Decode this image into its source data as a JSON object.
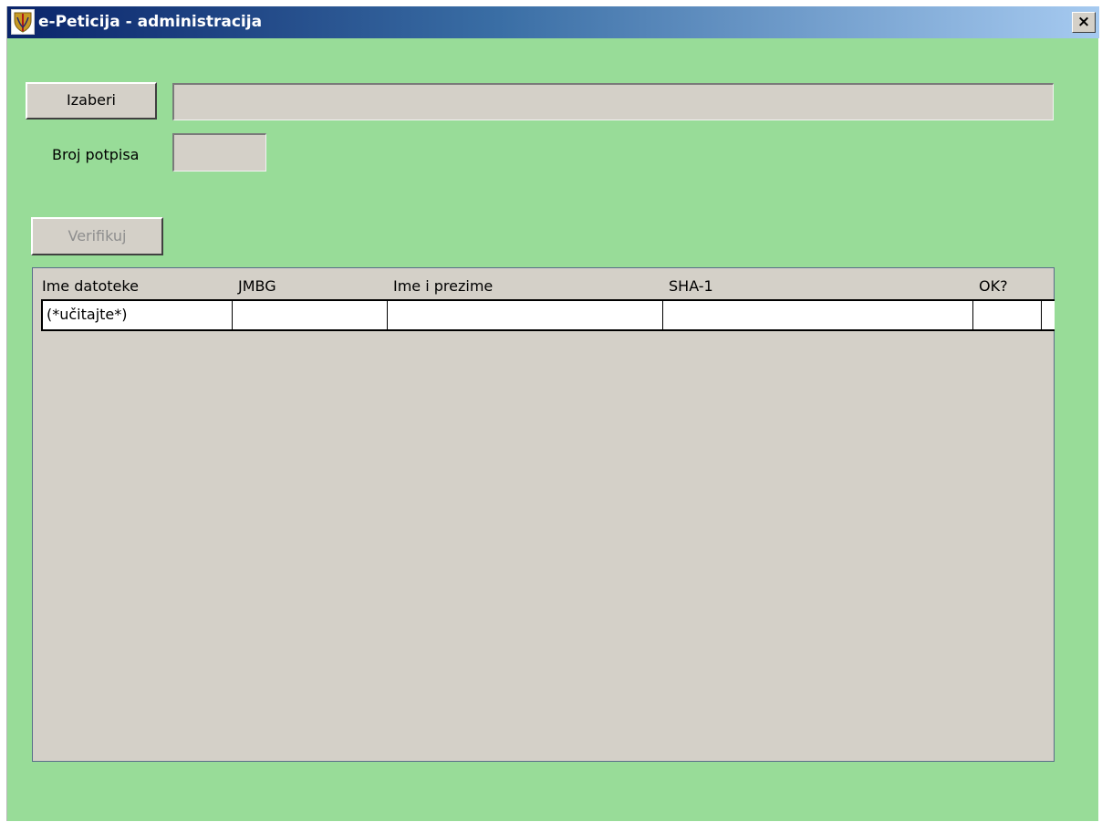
{
  "window": {
    "title": "e-Peticija - administracija",
    "close_label": "×",
    "background": "#98dc98"
  },
  "form": {
    "choose_button": "Izaberi",
    "file_path_value": "",
    "signature_count_label": "Broj potpisa",
    "signature_count_value": "",
    "verify_button": "Verifikuj",
    "verify_enabled": false
  },
  "table": {
    "columns": [
      "Ime datoteke",
      "JMBG",
      "Ime i prezime",
      "SHA-1",
      "OK?"
    ],
    "rows": [
      [
        "(*učitajte*)",
        "",
        "",
        "",
        ""
      ]
    ]
  },
  "icons": {
    "app_icon": "shield-emblem-icon"
  }
}
